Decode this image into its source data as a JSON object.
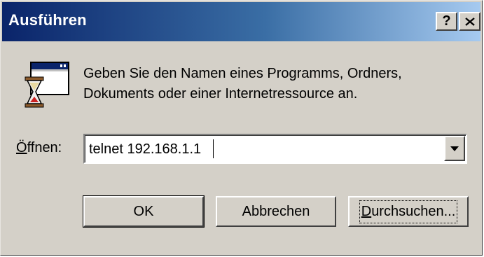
{
  "window": {
    "title": "Ausführen",
    "help_button": "?",
    "close_button": "X"
  },
  "description": {
    "line1": "Geben Sie den Namen eines Programms, Ordners,",
    "line2": "Dokuments oder einer Internetressource an."
  },
  "open_field": {
    "label_underlined": "Ö",
    "label_rest": "ffnen:",
    "value": "telnet 192.168.1.1"
  },
  "buttons": {
    "ok": "OK",
    "cancel": "Abbrechen",
    "browse_underlined": "D",
    "browse_rest": "urchsuchen..."
  },
  "colors": {
    "face": "#d4d0c8",
    "title_start": "#0a246a",
    "title_end": "#a6caf0"
  },
  "icons": [
    "run-program-icon",
    "help-icon",
    "close-icon",
    "dropdown-arrow-icon"
  ]
}
